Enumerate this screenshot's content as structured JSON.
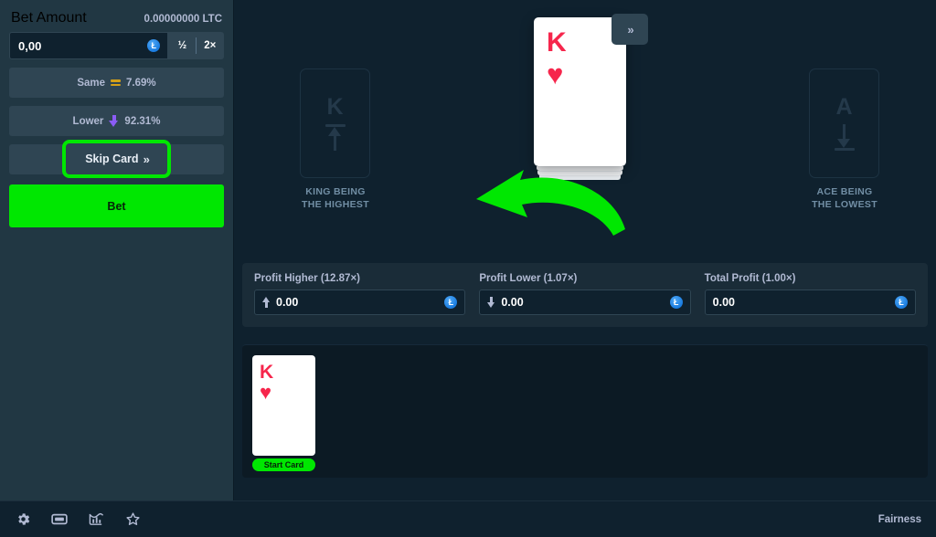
{
  "sidebar": {
    "bet_amount_label": "Bet Amount",
    "balance": "0.00000000 LTC",
    "bet_input_value": "0,00",
    "bet_input_placeholder": "0.00",
    "half_label": "½",
    "double_label": "2×",
    "coin_glyph": "Ł",
    "same": {
      "label": "Same",
      "value": "7.69%",
      "icon": "equals-icon",
      "icon_color": "#d4a017"
    },
    "lower": {
      "label": "Lower",
      "value": "92.31%",
      "icon": "arrow-down-icon",
      "icon_color": "#8b5cf6"
    },
    "skip_card_label": "Skip Card",
    "skip_card_chevron": "»",
    "bet_button_label": "Bet"
  },
  "stage": {
    "ghost_left": {
      "rank": "K",
      "icon": "arrow-up-over-line-icon",
      "caption_line1": "KING BEING",
      "caption_line2": "THE HIGHEST"
    },
    "ghost_right": {
      "rank": "A",
      "icon": "arrow-down-over-line-icon",
      "caption_line1": "ACE BEING",
      "caption_line2": "THE LOWEST"
    },
    "active_card": {
      "rank": "K",
      "suit": "♥",
      "suit_name": "hearts",
      "color": "#f6264c"
    },
    "skip_float_chevron": "»"
  },
  "profit": {
    "higher": {
      "label": "Profit Higher (12.87×)",
      "value": "0.00",
      "icon": "arrow-up-icon"
    },
    "lower": {
      "label": "Profit Lower (1.07×)",
      "value": "0.00",
      "icon": "arrow-down-icon"
    },
    "total": {
      "label": "Total Profit (1.00×)",
      "value": "0.00"
    }
  },
  "history": {
    "items": [
      {
        "rank": "K",
        "suit": "♥",
        "badge": "Start Card"
      }
    ]
  },
  "bottombar": {
    "icons": [
      "gear-icon",
      "display-icon",
      "stats-icon",
      "star-icon"
    ],
    "fairness_label": "Fairness"
  },
  "annotation": {
    "arrow_color": "#00e701",
    "arrow_name": "green-annotation-arrow"
  },
  "colors": {
    "accent_green": "#00e701",
    "sidebar_bg": "#213743",
    "stage_bg": "#0f212e",
    "panel_bg": "#1a2c38",
    "input_bg": "#0f212e",
    "card_red": "#f6264c"
  }
}
